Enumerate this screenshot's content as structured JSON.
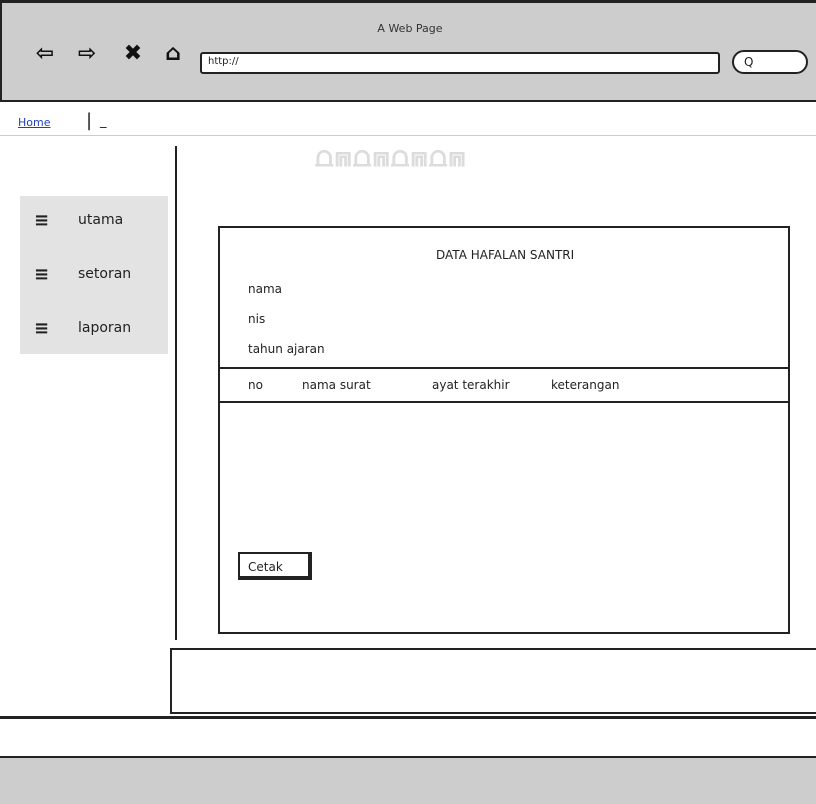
{
  "window": {
    "title": "A Web Page"
  },
  "browser": {
    "address": "http://",
    "search_icon_glyph": "Q"
  },
  "breadcrumb": {
    "home": "Home",
    "current": "_"
  },
  "sidebar": {
    "items": [
      {
        "label": "utama"
      },
      {
        "label": "setoran"
      },
      {
        "label": "laporan"
      }
    ]
  },
  "card": {
    "title": "DATA HAFALAN SANTRI",
    "fields": [
      "nama",
      "nis",
      "tahun ajaran"
    ],
    "columns": [
      "no",
      "nama surat",
      "ayat terakhir",
      "keterangan"
    ],
    "print_button": "Cetak"
  }
}
